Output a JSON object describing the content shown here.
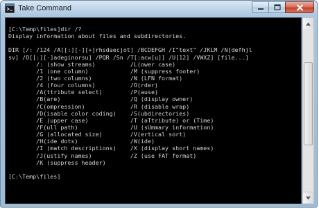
{
  "window": {
    "title": "Take Command",
    "icon": "console-icon",
    "controls": {
      "minimize": "minimize-icon",
      "maximize": "maximize-icon",
      "close": "close-icon",
      "close_color": "#c4432a"
    }
  },
  "console": {
    "background": "#000000",
    "text_color": "#d6d6d6",
    "lines": [
      "[C:\\Temp\\files]dir /?",
      "Display information about files and subdirectories.",
      "",
      "DIR [/: /124 /A[[:][-][+]rhsdaecjot] /BCDEFGH /I\"text\" /JKLM /N[defhjl",
      "sv] /O[[:][-]adeginorsu] /PQR /Sn /T[:acw[u]] /U[12] /VWXZ] [file...]",
      "        /: (show streams)          /L(ower case)",
      "        /1 (one column)            /M (suppress footer)",
      "        /2 (two columns)           /N (LFN format)",
      "        /4 (four columns)          /O(rder)",
      "        /A(ttribute select)        /P(ause)",
      "        /B(are)                    /Q (display owner)",
      "        /C(ompression)             /R (disable wrap)",
      "        /D(isable color coding)    /S(ubdirectories)",
      "        /E (upper case)            /T (aTtribute) or (Time)",
      "        /F(ull path)               /U (sUmmary information)",
      "        /G (allocated size)        /V(ertical sort)",
      "        /H(ide dots)               /W(ide)",
      "        /I (match descriptions)    /X (display short names)",
      "        /J(ustify names)           /Z (use FAT format)",
      "        /K (suppress header)",
      "",
      "[C:\\Temp\\files]"
    ]
  },
  "scrollbar": {
    "up": "scroll-up-arrow-icon",
    "down": "scroll-down-arrow-icon"
  }
}
